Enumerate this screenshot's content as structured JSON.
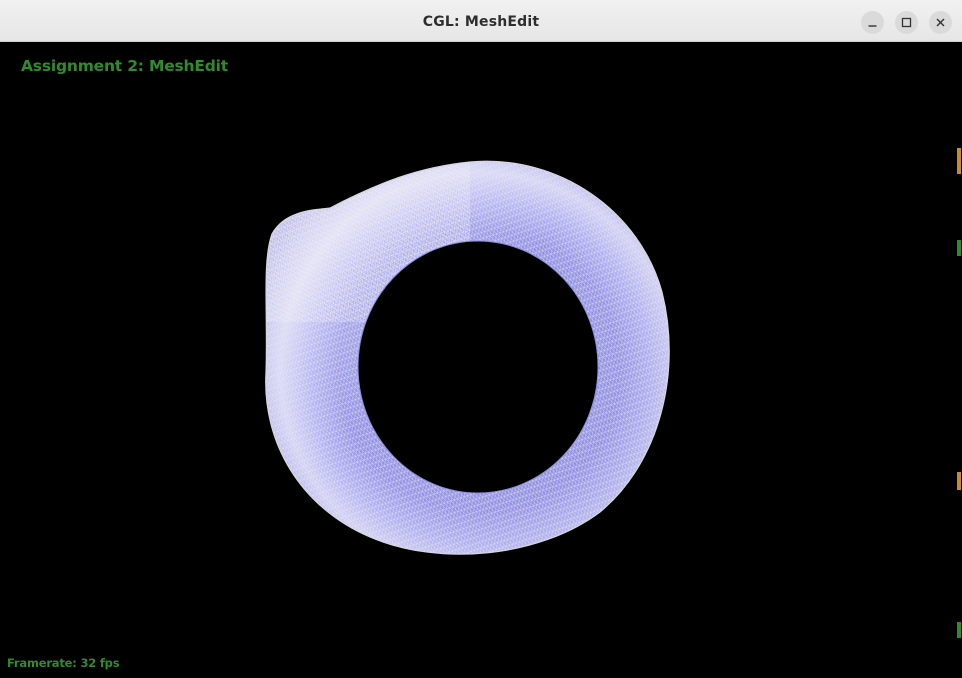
{
  "window": {
    "title": "CGL: MeshEdit",
    "controls": {
      "minimize": "minimize-icon",
      "maximize": "maximize-icon",
      "close": "close-icon"
    }
  },
  "app": {
    "title": "Assignment 2: MeshEdit",
    "framerate_text": "Framerate: 32 fps",
    "title_color": "#2f8c2b"
  },
  "mesh": {
    "description_icon": "torus-wireframe",
    "surface_color": "#9d9cf2",
    "edge_color": "#b8b8b8",
    "background": "#000000"
  }
}
